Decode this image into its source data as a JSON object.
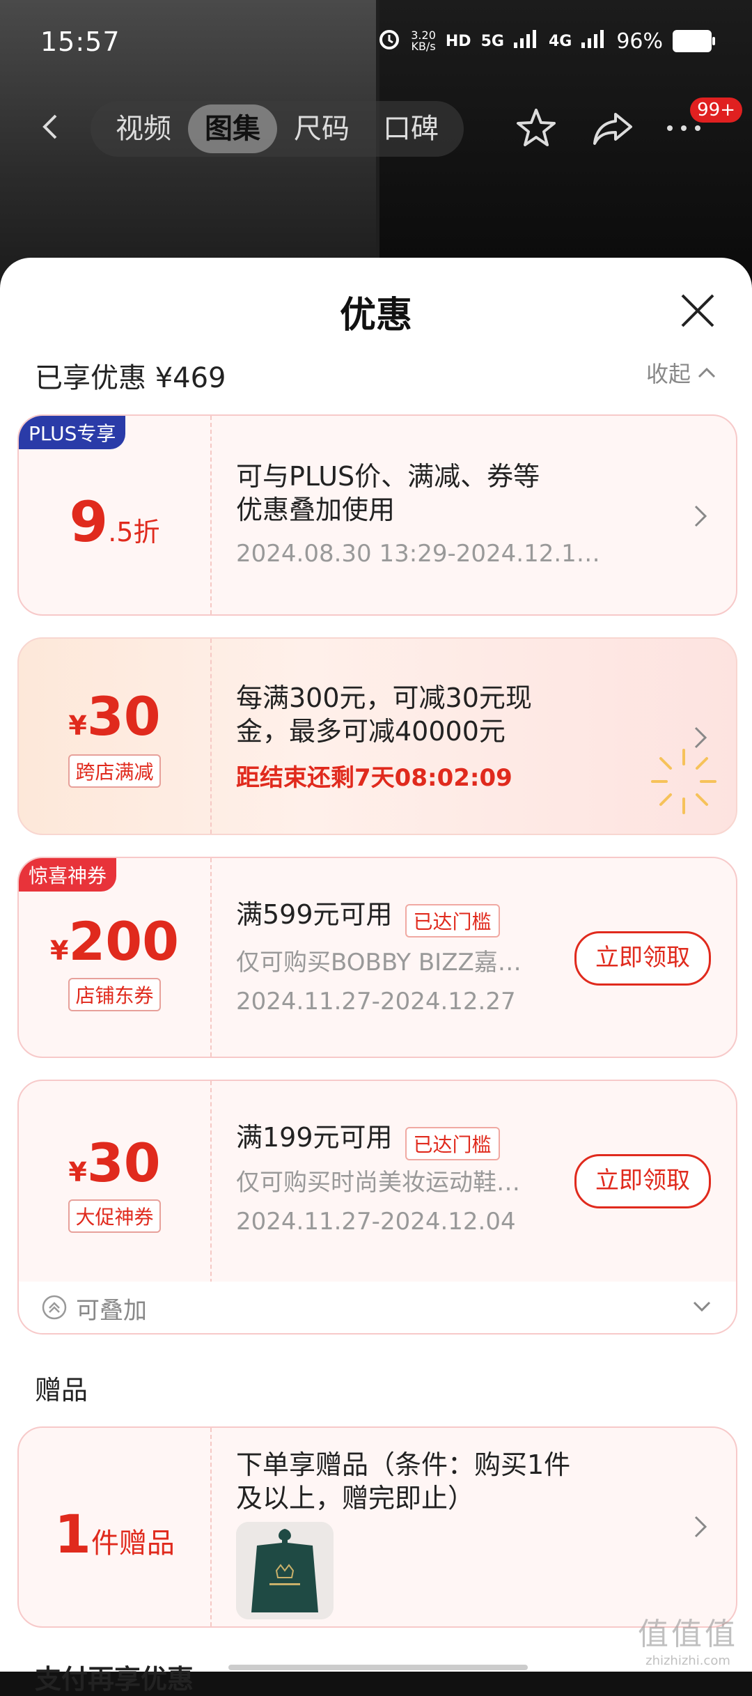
{
  "status": {
    "time": "15:57",
    "speed": "3.20",
    "speed_unit": "KB/s",
    "hd": "HD",
    "network1": "5G",
    "network2": "4G",
    "battery": "96%"
  },
  "nav": {
    "tabs": [
      {
        "label": "视频"
      },
      {
        "label": "图集"
      },
      {
        "label": "尺码"
      },
      {
        "label": "口碑"
      }
    ],
    "badge": "99+"
  },
  "sheet": {
    "title": "优惠",
    "enjoyed": "已享优惠 ¥469",
    "collapse": "收起"
  },
  "coupons": [
    {
      "corner": "PLUS专享",
      "value": "9",
      "suffix": ".5折",
      "line1": "可与PLUS价、满减、券等",
      "line2": "优惠叠加使用",
      "date": "2024.08.30 13:29-2024.12.1…"
    },
    {
      "currency": "¥",
      "value": "30",
      "tag": "跨店满减",
      "line1": "每满300元，可减30元现",
      "line2": "金，最多可减40000元",
      "countdown": "距结束还剩7天08:02:09"
    },
    {
      "corner": "惊喜神券",
      "currency": "¥",
      "value": "200",
      "tag": "店铺东券",
      "line1": "满599元可用",
      "threshold": "已达门槛",
      "desc": "仅可购买BOBBY BIZZ嘉…",
      "date": "2024.11.27-2024.12.27",
      "button": "立即领取"
    },
    {
      "currency": "¥",
      "value": "30",
      "tag": "大促神券",
      "line1": "满199元可用",
      "threshold": "已达门槛",
      "desc": "仅可购买时尚美妆运动鞋…",
      "date": "2024.11.27-2024.12.04",
      "button": "立即领取"
    }
  ],
  "stackable": "可叠加",
  "gift_section": {
    "title": "赠品",
    "count": "1",
    "unit": "件赠品",
    "line1": "下单享赠品（条件：购买1件",
    "line2": "及以上，赠完即止）"
  },
  "pay_section": "支付再享优惠",
  "watermark": {
    "brand": "值值值",
    "site": "zhizhizhi.com"
  }
}
